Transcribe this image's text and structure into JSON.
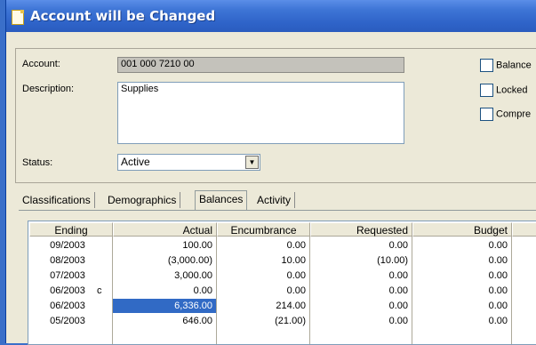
{
  "window": {
    "title": "Account will be Changed"
  },
  "form": {
    "account_label": "Account:",
    "account_value": "001 000 7210 00",
    "description_label": "Description:",
    "description_value": "Supplies",
    "status_label": "Status:",
    "status_value": "Active"
  },
  "checkboxes": [
    {
      "label": "Balance",
      "checked": false
    },
    {
      "label": "Locked",
      "checked": false
    },
    {
      "label": "Compre",
      "checked": false
    }
  ],
  "tabs": [
    "Classifications",
    "Demographics",
    "Balances",
    "Activity"
  ],
  "active_tab": "Balances",
  "grid": {
    "columns": [
      "Ending",
      "Actual",
      "Encumbrance",
      "Requested",
      "Budget"
    ],
    "rows": [
      {
        "ending": "09/2003",
        "flag": "",
        "actual": "100.00",
        "encumbrance": "0.00",
        "requested": "0.00",
        "budget": "0.00"
      },
      {
        "ending": "08/2003",
        "flag": "",
        "actual": "(3,000.00)",
        "encumbrance": "10.00",
        "requested": "(10.00)",
        "budget": "0.00"
      },
      {
        "ending": "07/2003",
        "flag": "",
        "actual": "3,000.00",
        "encumbrance": "0.00",
        "requested": "0.00",
        "budget": "0.00"
      },
      {
        "ending": "06/2003",
        "flag": "c",
        "actual": "0.00",
        "encumbrance": "0.00",
        "requested": "0.00",
        "budget": "0.00"
      },
      {
        "ending": "06/2003",
        "flag": "",
        "actual": "6,336.00",
        "encumbrance": "214.00",
        "requested": "0.00",
        "budget": "0.00",
        "selected_cell": "actual"
      },
      {
        "ending": "05/2003",
        "flag": "",
        "actual": "646.00",
        "encumbrance": "(21.00)",
        "requested": "0.00",
        "budget": "0.00"
      }
    ]
  },
  "colors": {
    "titlebar": "#2f64c9",
    "selection": "#316ac5",
    "dialog_bg": "#ece9d8"
  }
}
